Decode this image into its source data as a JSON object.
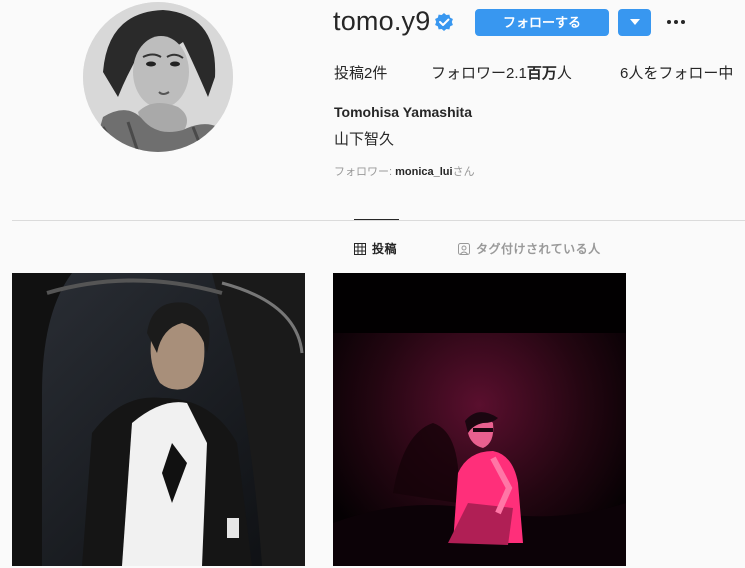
{
  "profile": {
    "username": "tomo.y9",
    "full_name": "Tomohisa Yamashita",
    "bio": "山下智久",
    "follow_label": "フォローする",
    "stats": {
      "posts_prefix": "投稿",
      "posts_count": "2",
      "posts_suffix": "件",
      "followers_prefix": "フォロワー",
      "followers_count": "2.1",
      "followers_unit": "百万",
      "followers_suffix": "人",
      "following_count": "6",
      "following_suffix": "人をフォロー中"
    },
    "followed_by": {
      "prefix": "フォロワー: ",
      "name": "monica_lui",
      "suffix": "さん"
    }
  },
  "tabs": {
    "posts": "投稿",
    "tagged": "タグ付けされている人"
  },
  "colors": {
    "accent": "#3897f0",
    "verified": "#3897f0",
    "text": "#262626",
    "muted": "#999999",
    "divider": "#dbdbdb"
  },
  "icons": {
    "verified": "verified-badge-icon",
    "dropdown": "chevron-down-icon",
    "more": "more-options-icon",
    "grid": "grid-icon",
    "tagged": "tagged-person-icon"
  }
}
